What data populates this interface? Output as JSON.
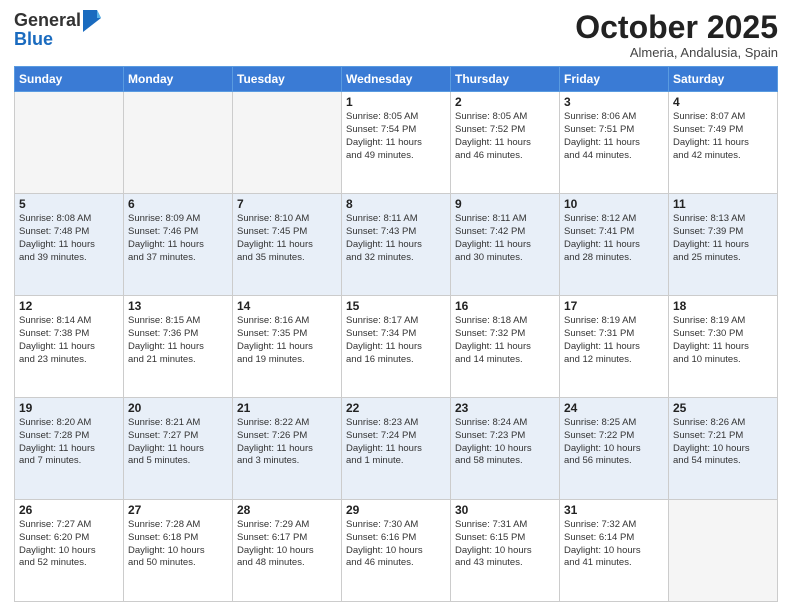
{
  "logo": {
    "general": "General",
    "blue": "Blue"
  },
  "title": "October 2025",
  "location": "Almeria, Andalusia, Spain",
  "weekdays": [
    "Sunday",
    "Monday",
    "Tuesday",
    "Wednesday",
    "Thursday",
    "Friday",
    "Saturday"
  ],
  "weeks": [
    [
      {
        "day": "",
        "info": ""
      },
      {
        "day": "",
        "info": ""
      },
      {
        "day": "",
        "info": ""
      },
      {
        "day": "1",
        "info": "Sunrise: 8:05 AM\nSunset: 7:54 PM\nDaylight: 11 hours\nand 49 minutes."
      },
      {
        "day": "2",
        "info": "Sunrise: 8:05 AM\nSunset: 7:52 PM\nDaylight: 11 hours\nand 46 minutes."
      },
      {
        "day": "3",
        "info": "Sunrise: 8:06 AM\nSunset: 7:51 PM\nDaylight: 11 hours\nand 44 minutes."
      },
      {
        "day": "4",
        "info": "Sunrise: 8:07 AM\nSunset: 7:49 PM\nDaylight: 11 hours\nand 42 minutes."
      }
    ],
    [
      {
        "day": "5",
        "info": "Sunrise: 8:08 AM\nSunset: 7:48 PM\nDaylight: 11 hours\nand 39 minutes."
      },
      {
        "day": "6",
        "info": "Sunrise: 8:09 AM\nSunset: 7:46 PM\nDaylight: 11 hours\nand 37 minutes."
      },
      {
        "day": "7",
        "info": "Sunrise: 8:10 AM\nSunset: 7:45 PM\nDaylight: 11 hours\nand 35 minutes."
      },
      {
        "day": "8",
        "info": "Sunrise: 8:11 AM\nSunset: 7:43 PM\nDaylight: 11 hours\nand 32 minutes."
      },
      {
        "day": "9",
        "info": "Sunrise: 8:11 AM\nSunset: 7:42 PM\nDaylight: 11 hours\nand 30 minutes."
      },
      {
        "day": "10",
        "info": "Sunrise: 8:12 AM\nSunset: 7:41 PM\nDaylight: 11 hours\nand 28 minutes."
      },
      {
        "day": "11",
        "info": "Sunrise: 8:13 AM\nSunset: 7:39 PM\nDaylight: 11 hours\nand 25 minutes."
      }
    ],
    [
      {
        "day": "12",
        "info": "Sunrise: 8:14 AM\nSunset: 7:38 PM\nDaylight: 11 hours\nand 23 minutes."
      },
      {
        "day": "13",
        "info": "Sunrise: 8:15 AM\nSunset: 7:36 PM\nDaylight: 11 hours\nand 21 minutes."
      },
      {
        "day": "14",
        "info": "Sunrise: 8:16 AM\nSunset: 7:35 PM\nDaylight: 11 hours\nand 19 minutes."
      },
      {
        "day": "15",
        "info": "Sunrise: 8:17 AM\nSunset: 7:34 PM\nDaylight: 11 hours\nand 16 minutes."
      },
      {
        "day": "16",
        "info": "Sunrise: 8:18 AM\nSunset: 7:32 PM\nDaylight: 11 hours\nand 14 minutes."
      },
      {
        "day": "17",
        "info": "Sunrise: 8:19 AM\nSunset: 7:31 PM\nDaylight: 11 hours\nand 12 minutes."
      },
      {
        "day": "18",
        "info": "Sunrise: 8:19 AM\nSunset: 7:30 PM\nDaylight: 11 hours\nand 10 minutes."
      }
    ],
    [
      {
        "day": "19",
        "info": "Sunrise: 8:20 AM\nSunset: 7:28 PM\nDaylight: 11 hours\nand 7 minutes."
      },
      {
        "day": "20",
        "info": "Sunrise: 8:21 AM\nSunset: 7:27 PM\nDaylight: 11 hours\nand 5 minutes."
      },
      {
        "day": "21",
        "info": "Sunrise: 8:22 AM\nSunset: 7:26 PM\nDaylight: 11 hours\nand 3 minutes."
      },
      {
        "day": "22",
        "info": "Sunrise: 8:23 AM\nSunset: 7:24 PM\nDaylight: 11 hours\nand 1 minute."
      },
      {
        "day": "23",
        "info": "Sunrise: 8:24 AM\nSunset: 7:23 PM\nDaylight: 10 hours\nand 58 minutes."
      },
      {
        "day": "24",
        "info": "Sunrise: 8:25 AM\nSunset: 7:22 PM\nDaylight: 10 hours\nand 56 minutes."
      },
      {
        "day": "25",
        "info": "Sunrise: 8:26 AM\nSunset: 7:21 PM\nDaylight: 10 hours\nand 54 minutes."
      }
    ],
    [
      {
        "day": "26",
        "info": "Sunrise: 7:27 AM\nSunset: 6:20 PM\nDaylight: 10 hours\nand 52 minutes."
      },
      {
        "day": "27",
        "info": "Sunrise: 7:28 AM\nSunset: 6:18 PM\nDaylight: 10 hours\nand 50 minutes."
      },
      {
        "day": "28",
        "info": "Sunrise: 7:29 AM\nSunset: 6:17 PM\nDaylight: 10 hours\nand 48 minutes."
      },
      {
        "day": "29",
        "info": "Sunrise: 7:30 AM\nSunset: 6:16 PM\nDaylight: 10 hours\nand 46 minutes."
      },
      {
        "day": "30",
        "info": "Sunrise: 7:31 AM\nSunset: 6:15 PM\nDaylight: 10 hours\nand 43 minutes."
      },
      {
        "day": "31",
        "info": "Sunrise: 7:32 AM\nSunset: 6:14 PM\nDaylight: 10 hours\nand 41 minutes."
      },
      {
        "day": "",
        "info": ""
      }
    ]
  ]
}
